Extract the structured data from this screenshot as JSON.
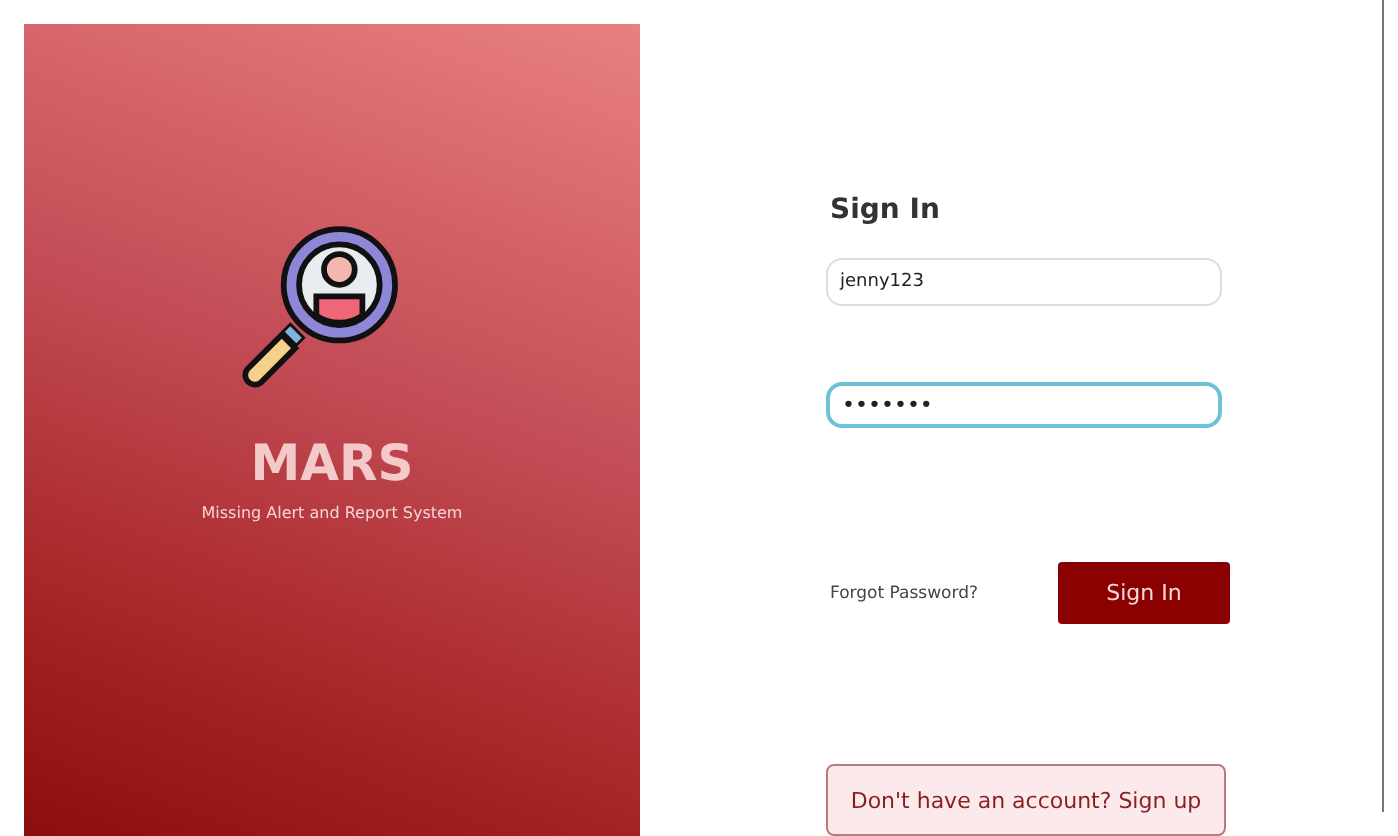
{
  "brand": {
    "title": "MARS",
    "subtitle": "Missing Alert and Report System"
  },
  "form": {
    "heading": "Sign In",
    "fields": [
      {
        "kind": "text",
        "value": "jenny123",
        "focused": false
      },
      {
        "kind": "password",
        "value": "•••••••",
        "focused": true
      }
    ],
    "forgot_link": "Forgot Password?",
    "submit_button": "Sign In",
    "signup_button": "Don't have an account? Sign up"
  }
}
